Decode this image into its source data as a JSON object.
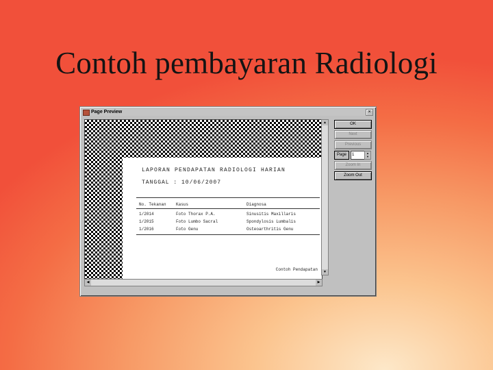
{
  "slide": {
    "title": "Contoh pembayaran Radiologi"
  },
  "window": {
    "title": "Page Preview",
    "close_label": "×",
    "buttons": {
      "ok": "OK",
      "next": "Next",
      "previous": "Previous",
      "page": "Page",
      "page_value": "1",
      "zoom_in": "Zoom In",
      "zoom_out": "Zoom Out"
    }
  },
  "report": {
    "title": "LAPORAN PENDAPATAN RADIOLOGI HARIAN",
    "date_line": "TANGGAL : 10/06/2007",
    "columns": [
      "No. Tekanan",
      "Kasus",
      "Diagnosa"
    ],
    "rows": [
      [
        "1/2014",
        "Foto Thorax P.A.",
        "Sinusitis Maxillaris"
      ],
      [
        "1/2015",
        "Foto Lumbo Sacral",
        "Spondylosis Lumbalis"
      ],
      [
        "1/2016",
        "Foto Genu",
        "Osteoarthritis Genu"
      ]
    ],
    "footer": "Contoh Pendapatan"
  },
  "accent_colors": {
    "background_top": "#f1503a",
    "background_bottom": "#fde8c9",
    "window_face": "#c0c0c0"
  }
}
